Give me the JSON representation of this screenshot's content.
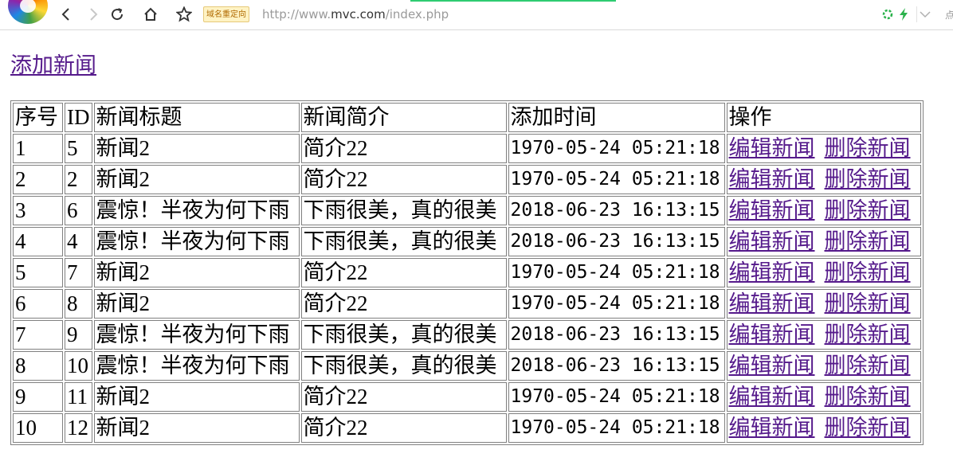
{
  "browser": {
    "redirect_badge": "域名重定向",
    "url_scheme": "http://www.",
    "url_host": "mvc.com",
    "url_path": "/index.php",
    "cut_char": "点",
    "accent_progress_color": "#2ecc71",
    "icons": [
      "back-icon",
      "forward-icon",
      "reload-icon",
      "home-icon",
      "star-icon",
      "shield-icon",
      "lightning-icon",
      "chevron-down-icon"
    ]
  },
  "page": {
    "add_link": "添加新闻",
    "link_color": "#551a8b"
  },
  "table": {
    "headers": {
      "seq": "序号",
      "id": "ID",
      "title": "新闻标题",
      "desc": "新闻简介",
      "time": "添加时间",
      "op": "操作"
    },
    "edit_label": "编辑新闻",
    "delete_label": "删除新闻",
    "rows": [
      {
        "seq": "1",
        "id": "5",
        "title": "新闻2",
        "desc": "简介22",
        "time": "1970-05-24 05:21:18"
      },
      {
        "seq": "2",
        "id": "2",
        "title": "新闻2",
        "desc": "简介22",
        "time": "1970-05-24 05:21:18"
      },
      {
        "seq": "3",
        "id": "6",
        "title": "震惊！半夜为何下雨",
        "desc": "下雨很美，真的很美",
        "time": "2018-06-23 16:13:15"
      },
      {
        "seq": "4",
        "id": "4",
        "title": "震惊！半夜为何下雨",
        "desc": "下雨很美，真的很美",
        "time": "2018-06-23 16:13:15"
      },
      {
        "seq": "5",
        "id": "7",
        "title": "新闻2",
        "desc": "简介22",
        "time": "1970-05-24 05:21:18"
      },
      {
        "seq": "6",
        "id": "8",
        "title": "新闻2",
        "desc": "简介22",
        "time": "1970-05-24 05:21:18"
      },
      {
        "seq": "7",
        "id": "9",
        "title": "震惊！半夜为何下雨",
        "desc": "下雨很美，真的很美",
        "time": "2018-06-23 16:13:15"
      },
      {
        "seq": "8",
        "id": "10",
        "title": "震惊！半夜为何下雨",
        "desc": "下雨很美，真的很美",
        "time": "2018-06-23 16:13:15"
      },
      {
        "seq": "9",
        "id": "11",
        "title": "新闻2",
        "desc": "简介22",
        "time": "1970-05-24 05:21:18"
      },
      {
        "seq": "10",
        "id": "12",
        "title": "新闻2",
        "desc": "简介22",
        "time": "1970-05-24 05:21:18"
      }
    ]
  }
}
